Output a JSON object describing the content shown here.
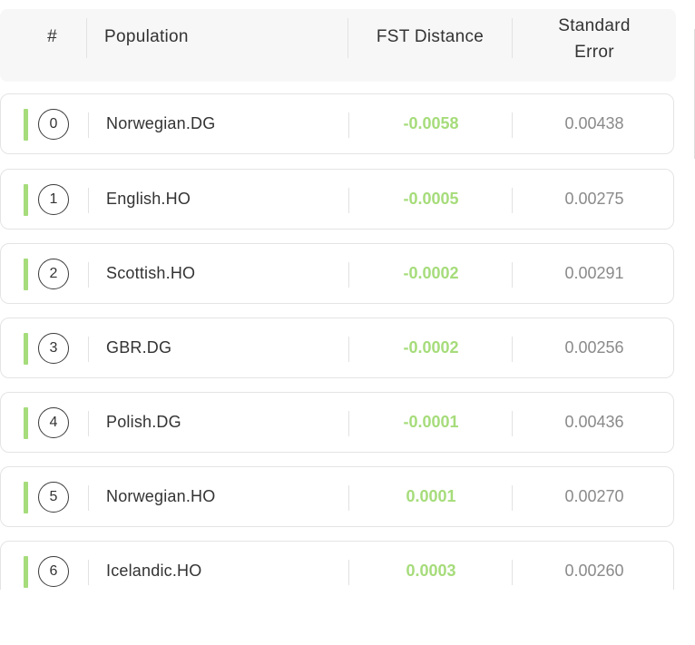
{
  "table": {
    "columns": {
      "rank": "#",
      "population": "Population",
      "fst": "FST Distance",
      "se_line1": "Standard",
      "se_line2": "Error"
    },
    "rows": [
      {
        "rank": "0",
        "population": "Norwegian.DG",
        "fst": "-0.0058",
        "se": "0.00438"
      },
      {
        "rank": "1",
        "population": "English.HO",
        "fst": "-0.0005",
        "se": "0.00275"
      },
      {
        "rank": "2",
        "population": "Scottish.HO",
        "fst": "-0.0002",
        "se": "0.00291"
      },
      {
        "rank": "3",
        "population": "GBR.DG",
        "fst": "-0.0002",
        "se": "0.00256"
      },
      {
        "rank": "4",
        "population": "Polish.DG",
        "fst": "-0.0001",
        "se": "0.00436"
      },
      {
        "rank": "5",
        "population": "Norwegian.HO",
        "fst": "0.0001",
        "se": "0.00270"
      },
      {
        "rank": "6",
        "population": "Icelandic.HO",
        "fst": "0.0003",
        "se": "0.00260"
      }
    ]
  },
  "colors": {
    "accent": "#a6dc7b",
    "header_bg": "#f7f7f7",
    "se_text": "#8a8a8a"
  }
}
